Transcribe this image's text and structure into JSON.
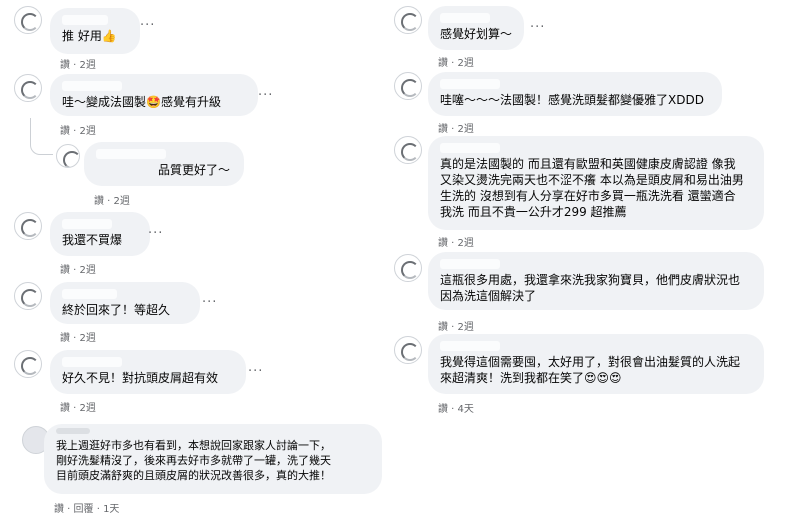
{
  "colors": {
    "bubble": "#f0f2f5",
    "meta_text": "#65676b",
    "body_text": "#050505",
    "heart_eyes_emoji": "#e0282f"
  },
  "comments_left": [
    {
      "text": "推 好用👍",
      "meta": "讚 · 2週",
      "avatar_icon": "user-avatar-icon"
    },
    {
      "text": "哇～變成法國製🤩感覺有升級",
      "meta": "讚 · 2週",
      "avatar_icon": "user-avatar-icon"
    },
    {
      "text": "品質更好了～",
      "meta": "讚 · 2週",
      "avatar_icon": "user-avatar-icon",
      "is_reply": true
    },
    {
      "text": "我還不買爆",
      "meta": "讚 · 2週",
      "avatar_icon": "user-avatar-icon"
    },
    {
      "text": "終於回來了！等超久",
      "meta": "讚 · 2週",
      "avatar_icon": "user-avatar-icon"
    },
    {
      "text": "好久不見！對抗頭皮屑超有效",
      "meta": "讚 · 2週",
      "avatar_icon": "user-avatar-icon"
    },
    {
      "text": "我上週逛好市多也有看到，本想說回家跟家人討論一下，\n剛好洗髮精沒了，後來再去好市多就帶了一罐，洗了幾天\n目前頭皮滿舒爽的且頭皮屑的狀況改善很多，真的大推！",
      "meta": "讚 · 回覆 · 1天",
      "avatar_icon": "user-avatar-icon",
      "has_name": true
    }
  ],
  "comments_right": [
    {
      "text": "感覺好划算～",
      "meta": "讚 · 2週",
      "avatar_icon": "user-avatar-icon"
    },
    {
      "text": "哇噻～～～法國製！感覺洗頭髮都變優雅了XDDD",
      "meta": "讚 · 2週",
      "avatar_icon": "user-avatar-icon"
    },
    {
      "text": "真的是法國製的 而且還有歐盟和英國健康皮膚認證 像我\n又染又燙洗完兩天也不涩不癢 本以為是頭皮屑和易出油男\n生洗的 沒想到有人分享在好市多買一瓶洗洗看 還蠻適合\n我洗 而且不貴一公升才299 超推薦",
      "meta": "讚 · 2週",
      "avatar_icon": "user-avatar-icon"
    },
    {
      "text": "這瓶很多用處，我還拿來洗我家狗寶貝，他們皮膚狀況也\n因為洗這個解決了",
      "meta": "讚 · 2週",
      "avatar_icon": "user-avatar-icon"
    },
    {
      "text": "我覺得這個需要囤，太好用了，對很會出油髮質的人洗起\n來超清爽！洗到我都在笑了😍😍😍",
      "meta": "讚 · 4天",
      "avatar_icon": "user-avatar-icon"
    }
  ],
  "more_icon_label": "···"
}
